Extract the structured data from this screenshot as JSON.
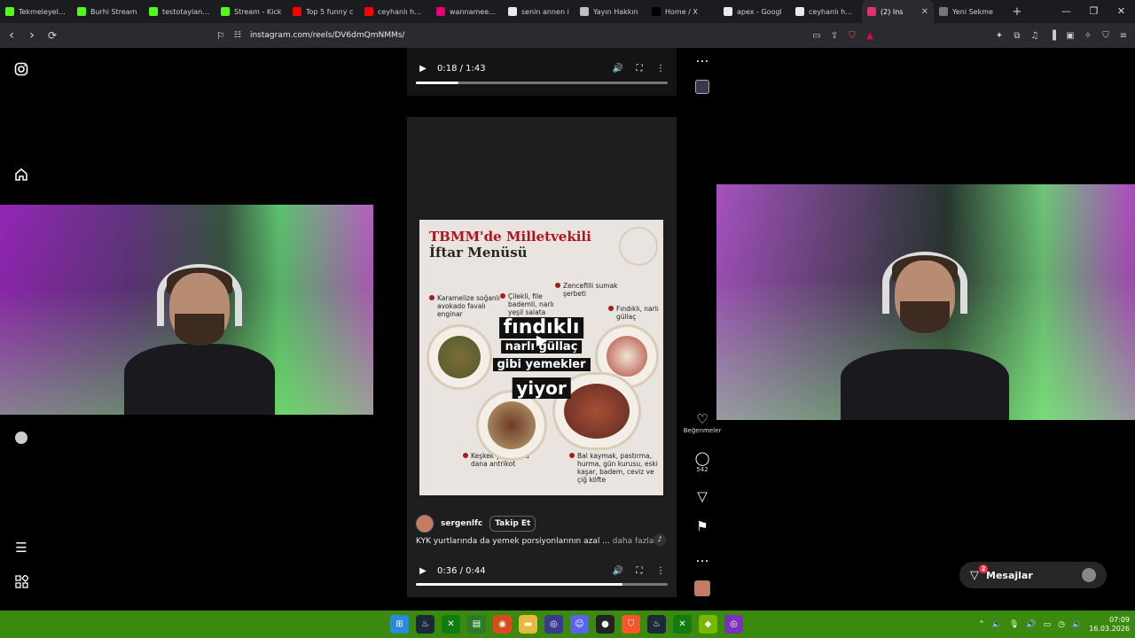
{
  "browser": {
    "tabs": [
      {
        "title": "Tekmeleyelan",
        "color": "#53fc18",
        "active": false
      },
      {
        "title": "Burhi Stream",
        "color": "#53fc18",
        "active": false
      },
      {
        "title": "testotaylan St",
        "color": "#53fc18",
        "active": false
      },
      {
        "title": "Stream - Kick",
        "color": "#53fc18",
        "active": false
      },
      {
        "title": "Top 5 funny c",
        "color": "#ff0000",
        "active": false
      },
      {
        "title": "ceyhanlı haka",
        "color": "#ff0000",
        "active": false
      },
      {
        "title": "wannameetm",
        "color": "#e60073",
        "active": false
      },
      {
        "title": "senin annen i",
        "color": "#e8eaed",
        "active": false
      },
      {
        "title": "Yayın Hakkın",
        "color": "#c0c0c0",
        "active": false
      },
      {
        "title": "Home / X",
        "color": "#000000",
        "active": false
      },
      {
        "title": "apex - Googl",
        "color": "#e8eaed",
        "active": false
      },
      {
        "title": "ceyhanlı haka",
        "color": "#e8eaed",
        "active": false
      },
      {
        "title": "(2) Ins",
        "color": "#e1306c",
        "active": true
      },
      {
        "title": "Yeni Sekme",
        "color": "#777777",
        "active": false
      }
    ],
    "url": "instagram.com/reels/DV6dmQmNMMs/"
  },
  "reels": {
    "top": {
      "time": "0:18 / 1:43",
      "progress": 0.17
    },
    "main": {
      "time": "0:36 / 0:44",
      "progress": 0.82,
      "author": "sergenlfc",
      "follow_label": "Takip Et",
      "caption": "KYK yurtlarında da yemek porsiyonlarının azal ...",
      "more_label": "daha fazla",
      "post": {
        "title1": "TBMM'de Milletvekili",
        "title2": "İftar Menüsü",
        "items": [
          {
            "text": "Karamelize soğanlı avokado favalı enginar"
          },
          {
            "text": "Çilekli, file bademli, narlı yeşil salata"
          },
          {
            "text": "Zencefilli sumak şerbeti"
          },
          {
            "text": "Fındıklı, narlı güllaç"
          },
          {
            "text": "Keşkek yatağında dana antrikot"
          },
          {
            "text": "Bal kaymak, pastırma, hurma, gün kurusu, eski kaşar, badem, ceviz ve çiğ köfte"
          }
        ],
        "overlay": [
          "fındıklı",
          "narlı güllaç",
          "gibi yemekler",
          "yiyor"
        ]
      }
    }
  },
  "actions": {
    "like_label": "Beğenmeler",
    "comment_count": "542"
  },
  "messages": {
    "label": "Mesajlar",
    "badge": "2"
  },
  "clock": {
    "time": "07:09",
    "date": "16.03.2026"
  }
}
